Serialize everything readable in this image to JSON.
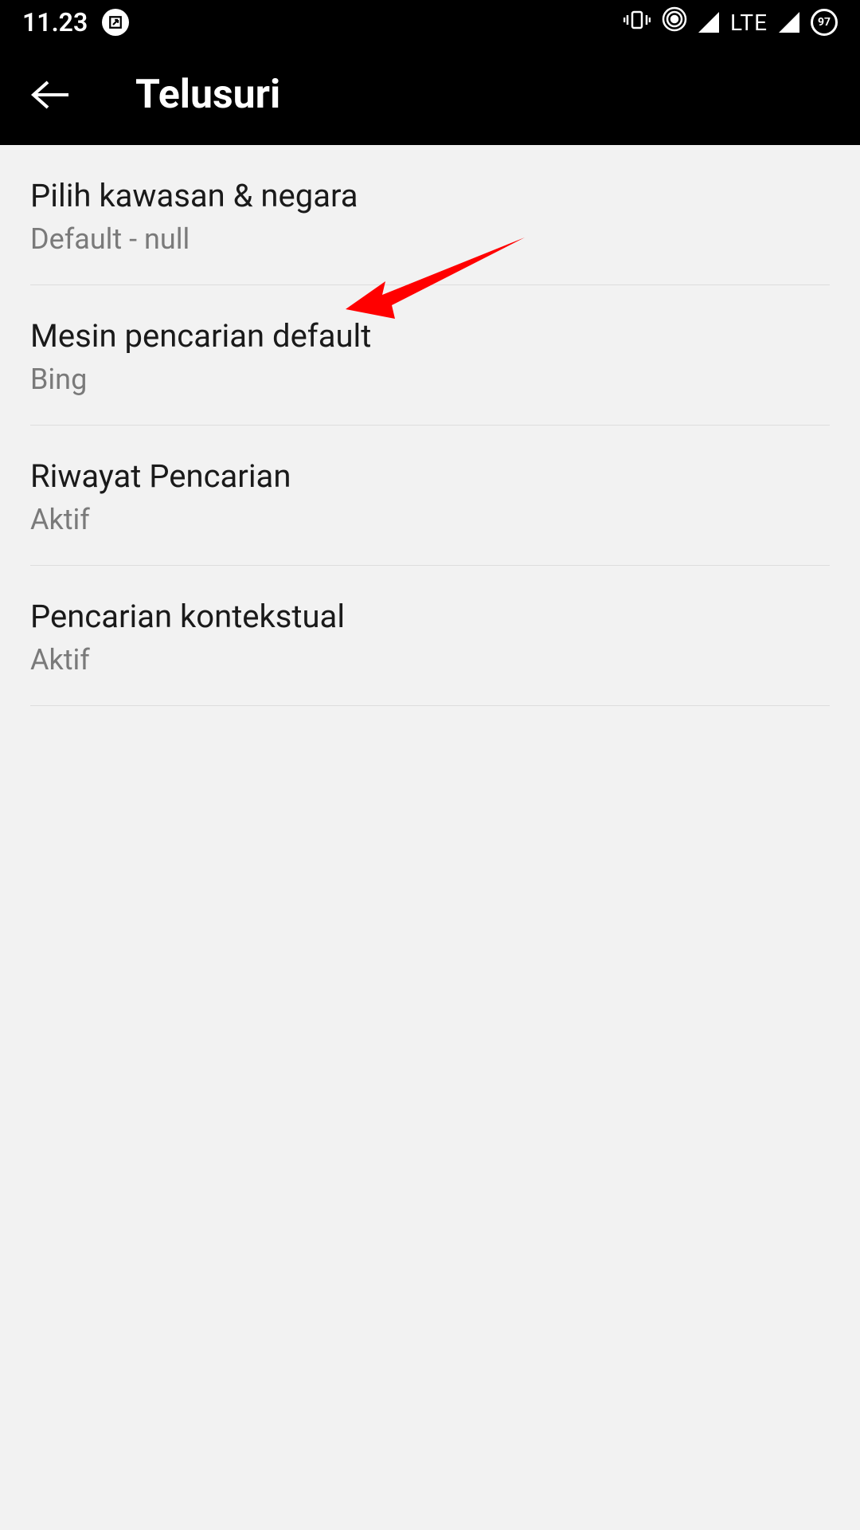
{
  "status_bar": {
    "time": "11.23",
    "lte_label": "LTE",
    "battery_level": "97"
  },
  "app_bar": {
    "title": "Telusuri"
  },
  "settings": [
    {
      "title": "Pilih kawasan & negara",
      "subtitle": "Default - null"
    },
    {
      "title": "Mesin pencarian default",
      "subtitle": "Bing"
    },
    {
      "title": "Riwayat Pencarian",
      "subtitle": "Aktif"
    },
    {
      "title": "Pencarian kontekstual",
      "subtitle": "Aktif"
    }
  ]
}
